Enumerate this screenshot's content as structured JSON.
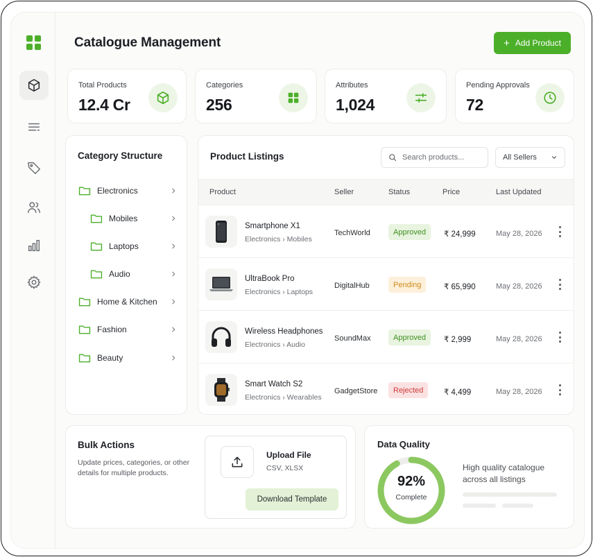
{
  "app": {
    "title": "Catalogue Management",
    "add_button": "Add Product"
  },
  "colors": {
    "accent": "#4caf2a",
    "accent_light": "#e3f1d6",
    "approved": "#3f8f22",
    "pending": "#d08a1a",
    "rejected": "#cf3a3a"
  },
  "sidebar": {
    "items": [
      {
        "name": "products",
        "icon": "box-icon",
        "active": true
      },
      {
        "name": "listings",
        "icon": "list-icon",
        "active": false
      },
      {
        "name": "pricing",
        "icon": "tag-icon",
        "active": false
      },
      {
        "name": "sellers",
        "icon": "users-icon",
        "active": false
      },
      {
        "name": "analytics",
        "icon": "bar-chart-icon",
        "active": false
      },
      {
        "name": "settings",
        "icon": "gear-icon",
        "active": false
      }
    ]
  },
  "stats": [
    {
      "label": "Total Products",
      "value": "12.4 Cr",
      "icon": "box-icon"
    },
    {
      "label": "Categories",
      "value": "256",
      "icon": "grid-icon"
    },
    {
      "label": "Attributes",
      "value": "1,024",
      "icon": "sliders-icon"
    },
    {
      "label": "Pending Approvals",
      "value": "72",
      "icon": "clock-icon"
    }
  ],
  "categories": {
    "title": "Category Structure",
    "items": [
      {
        "label": "Electronics",
        "level": 0
      },
      {
        "label": "Mobiles",
        "level": 1
      },
      {
        "label": "Laptops",
        "level": 1
      },
      {
        "label": "Audio",
        "level": 1
      },
      {
        "label": "Home & Kitchen",
        "level": 0
      },
      {
        "label": "Fashion",
        "level": 0
      },
      {
        "label": "Beauty",
        "level": 0
      }
    ]
  },
  "listings": {
    "title": "Product Listings",
    "search_placeholder": "Search products...",
    "seller_filter": "All Sellers",
    "columns": {
      "product": "Product",
      "seller": "Seller",
      "status": "Status",
      "price": "Price",
      "updated": "Last Updated"
    },
    "rows": [
      {
        "name": "Smartphone X1",
        "path": "Electronics › Mobiles",
        "seller": "TechWorld",
        "status": "Approved",
        "status_kind": "approved",
        "price": "₹ 24,999",
        "updated": "May 28, 2026",
        "thumb": "smartphone-icon"
      },
      {
        "name": "UltraBook Pro",
        "path": "Electronics › Laptops",
        "seller": "DigitalHub",
        "status": "Pending",
        "status_kind": "pending",
        "price": "₹ 65,990",
        "updated": "May 28, 2026",
        "thumb": "laptop-icon"
      },
      {
        "name": "Wireless Headphones",
        "path": "Electronics › Audio",
        "seller": "SoundMax",
        "status": "Approved",
        "status_kind": "approved",
        "price": "₹ 2,999",
        "updated": "May 28, 2026",
        "thumb": "headphones-icon"
      },
      {
        "name": "Smart Watch S2",
        "path": "Electronics › Wearables",
        "seller": "GadgetStore",
        "status": "Rejected",
        "status_kind": "rejected",
        "price": "₹ 4,499",
        "updated": "May 28, 2026",
        "thumb": "smartwatch-icon"
      }
    ]
  },
  "bulk": {
    "title": "Bulk Actions",
    "description": "Update prices, categories, or other details for multiple products.",
    "upload_title": "Upload File",
    "upload_formats": "CSV, XLSX",
    "download_button": "Download Template"
  },
  "quality": {
    "title": "Data Quality",
    "percent_label": "92%",
    "percent": 92,
    "sub": "Complete",
    "description": "High quality catalogue across all listings"
  }
}
